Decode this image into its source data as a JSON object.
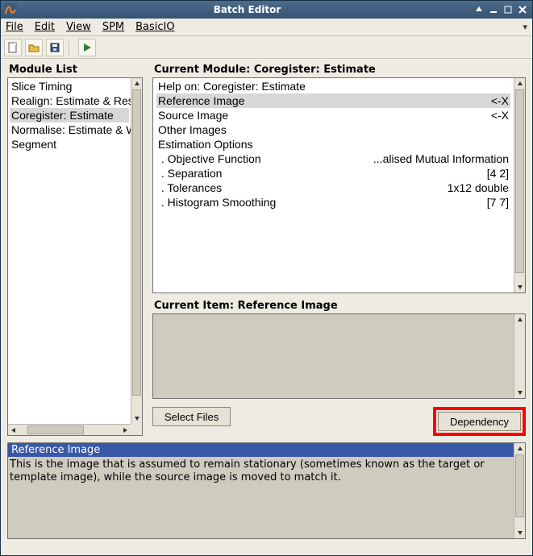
{
  "window": {
    "title": "Batch Editor"
  },
  "menubar": {
    "file": "File",
    "edit": "Edit",
    "view": "View",
    "spm": "SPM",
    "basicio": "BasicIO"
  },
  "module_list": {
    "label": "Module List",
    "items": [
      {
        "label": "Slice Timing",
        "selected": false
      },
      {
        "label": "Realign: Estimate & Reslice",
        "selected": false
      },
      {
        "label": "Coregister: Estimate",
        "selected": true
      },
      {
        "label": "Normalise: Estimate & Write",
        "selected": false
      },
      {
        "label": "Segment",
        "selected": false
      }
    ]
  },
  "current_module": {
    "label": "Current Module: Coregister: Estimate",
    "rows": [
      {
        "name": "Help on: Coregister: Estimate",
        "value": "",
        "selected": false
      },
      {
        "name": "Reference Image",
        "value": "<-X",
        "selected": true
      },
      {
        "name": "Source Image",
        "value": "<-X",
        "selected": false
      },
      {
        "name": "Other Images",
        "value": "",
        "selected": false
      },
      {
        "name": "Estimation Options",
        "value": "",
        "selected": false
      },
      {
        "name": " . Objective Function",
        "value": "...alised Mutual Information",
        "selected": false
      },
      {
        "name": " . Separation",
        "value": "[4 2]",
        "selected": false
      },
      {
        "name": " . Tolerances",
        "value": "1x12 double",
        "selected": false
      },
      {
        "name": " . Histogram Smoothing",
        "value": "[7 7]",
        "selected": false
      }
    ]
  },
  "current_item": {
    "label": "Current Item: Reference Image"
  },
  "buttons": {
    "select_files": "Select Files",
    "dependency": "Dependency"
  },
  "help": {
    "title": "Reference Image",
    "body": "This  is the image that is assumed to remain stationary (sometimes known as the target or template image), while the source image is moved to match it."
  }
}
